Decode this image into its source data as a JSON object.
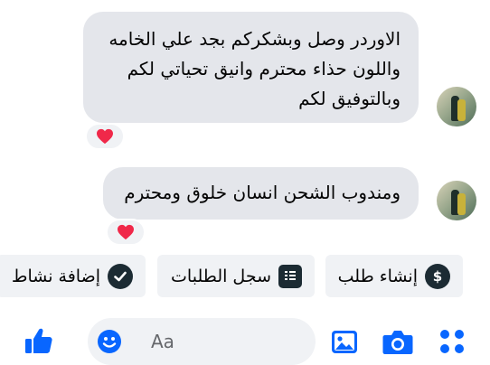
{
  "messages": [
    {
      "lines": [
        "الاوردر وصل وبشكركم بجد علي الخامه",
        "واللون حذاء محترم وانيق تحياتي لكم",
        "وبالتوفيق لكم"
      ],
      "reaction": "heart"
    },
    {
      "lines": [
        "ومندوب الشحن انسان خلوق ومحترم"
      ],
      "reaction": "heart"
    }
  ],
  "quick_actions": [
    {
      "label": "إنشاء طلب",
      "icon": "dollar-icon"
    },
    {
      "label": "سجل الطلبات",
      "icon": "receipt-list-icon"
    },
    {
      "label": "إضافة نشاط",
      "icon": "checkmark-icon"
    }
  ],
  "composer": {
    "placeholder": "Aa"
  },
  "colors": {
    "accent": "#0866ff",
    "bubble": "#e4e6eb",
    "reaction_heart": "#f02849",
    "chip_background": "#f0f2f5",
    "icon_dark": "#1c2b33"
  }
}
